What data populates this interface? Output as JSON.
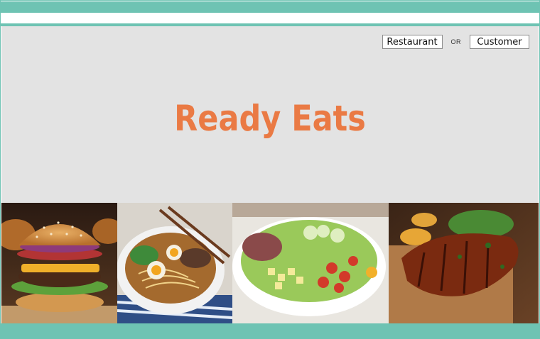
{
  "app": {
    "name": "Ready Eats"
  },
  "auth": {
    "restaurant_label": "Restaurant",
    "or_label": "OR",
    "customer_label": "Customer"
  },
  "gallery": [
    {
      "name": "burger"
    },
    {
      "name": "ramen"
    },
    {
      "name": "salad"
    },
    {
      "name": "ribs"
    }
  ],
  "colors": {
    "teal": "#6ec3b3",
    "hero_bg": "#e3e3e3",
    "brand": "#ea7a44"
  }
}
